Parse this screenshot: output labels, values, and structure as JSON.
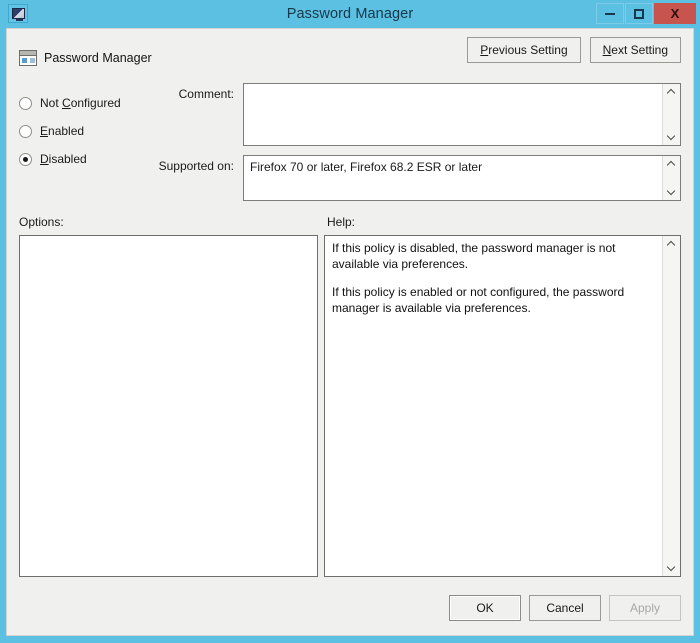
{
  "window": {
    "title": "Password Manager",
    "icon": "computer-policy-icon",
    "controls": {
      "minimize": "minimize-icon",
      "maximize": "maximize-icon",
      "close": "X"
    },
    "colors": {
      "titlebar": "#5cc0e2",
      "close_button": "#c8544e",
      "client_background": "#f0f0ee"
    }
  },
  "header": {
    "setting_name": "Password Manager",
    "icon": "policy-setting-icon",
    "previous_button": {
      "accel": "P",
      "rest": "revious Setting"
    },
    "next_button": {
      "accel": "N",
      "rest": "ext Setting"
    }
  },
  "state": {
    "options": [
      {
        "label_pre": "Not ",
        "accel": "C",
        "label_post": "onfigured",
        "selected": false,
        "name": "not-configured"
      },
      {
        "label_pre": "",
        "accel": "E",
        "label_post": "nabled",
        "selected": false,
        "name": "enabled"
      },
      {
        "label_pre": "",
        "accel": "D",
        "label_post": "isabled",
        "selected": true,
        "name": "disabled"
      }
    ]
  },
  "comment": {
    "label": "Comment:",
    "value": "",
    "placeholder": ""
  },
  "supported_on": {
    "label": "Supported on:",
    "value": "Firefox 70 or later, Firefox 68.2 ESR or later"
  },
  "panels": {
    "options_label": "Options:",
    "help_label": "Help:",
    "options_content": "",
    "help_paragraphs": [
      "If this policy is disabled, the password manager is not available via preferences.",
      "If this policy is enabled or not configured, the password manager is available via preferences."
    ]
  },
  "footer": {
    "ok": "OK",
    "cancel": "Cancel",
    "apply": "Apply",
    "apply_disabled": true
  }
}
